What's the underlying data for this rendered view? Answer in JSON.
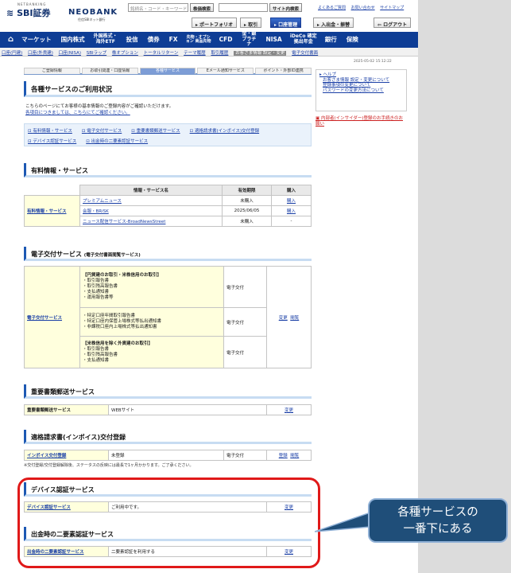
{
  "header": {
    "sbi_sub": "NETBANKING",
    "sbi_logo": "SBI証券",
    "neo_logo": "NEOBANK",
    "neo_sub": "住信SBIネット銀行",
    "search_placeholder": "銘柄名・コード・キーワード",
    "search_button": "株価検索",
    "site_search_button": "サイト内検索",
    "top_links": [
      "よくあるご質問",
      "お問い合わせ",
      "サイトマップ"
    ],
    "nav_buttons": [
      "ポートフォリオ",
      "取引",
      "口座管理",
      "入出金・振替"
    ],
    "logout": "ログアウト"
  },
  "main_nav": {
    "items": [
      "マーケット",
      "国内株式",
      "外国株式・海外ETF",
      "投信",
      "債券",
      "FX",
      "先物・オプション 商品先物",
      "CFD",
      "金・銀プラチナ",
      "NISA",
      "iDeCo 確定拠出年金",
      "銀行",
      "保険"
    ]
  },
  "sub_nav": {
    "items": [
      "口座(円建)",
      "口座(外貨建)",
      "口座(NISA)",
      "SBIラップ",
      "株オプション",
      "トータルリターン",
      "テーマ履歴",
      "取引履歴",
      "お客さま情報 設定・変更",
      "電子交付書面"
    ],
    "active_index": 8
  },
  "datestamp": "2025-05-02 15:12:22",
  "tabs": [
    "ご登録情報",
    "お取引関連・口座情報",
    "各種サービス",
    "Eメール通知サービス",
    "ポイント・外部ID連携"
  ],
  "page_title": "各種サービスのご利用状況",
  "intro": {
    "line1": "こちらのページにてお客様の基本情報のご登録内容がご確認いただけます。",
    "line2": "各項目につきましては、こちらにてご確認ください。"
  },
  "quick_links": {
    "row1": [
      "有料情報・サービス",
      "電子交付サービス",
      "重要書類郵送サービス",
      "適格請求書(インボイス)交付登録"
    ],
    "row2": [
      "デバイス認証サービス",
      "出金時の二要素認証サービス"
    ]
  },
  "paid": {
    "title": "有料情報・サービス",
    "headers": [
      "情報・サービス名",
      "有効期限",
      "購入"
    ],
    "row_label": "有料情報・サービス",
    "rows": [
      {
        "name": "プレミアムニュース",
        "expiry": "未購入",
        "action": "購入"
      },
      {
        "name": "会報・BRiSK",
        "expiry": "2025/06/05",
        "action": "購入"
      },
      {
        "name": "ニュース配信サービス-BroadNewsStreet",
        "expiry": "未購入",
        "action": "-"
      }
    ]
  },
  "edelivery": {
    "title": "電子交付サービス",
    "title_sub": "(電子交付書面閲覧サービス)",
    "row_label": "電子交付サービス",
    "groups": [
      {
        "head": "【円貨建のお取引・米株信用のお取引】",
        "items": "・取引報告書\n・取引残高報告書\n・支払通知書\n・運用報告書等",
        "status": "電子交付"
      },
      {
        "head": "",
        "items": "・特定口座年間取引報告書\n・特定口座内保管上場株式等払出通知書\n・非課税口座内上場株式等払出通知書",
        "status": "電子交付"
      },
      {
        "head": "【米株信用を除く外貨建のお取引】",
        "items": "・取引報告書\n・取引残高報告書\n・支払通知書",
        "status": "電子交付"
      }
    ],
    "actions": [
      "変更",
      "閲覧"
    ]
  },
  "mail": {
    "title": "重要書類郵送サービス",
    "label": "重要書類郵送サービス",
    "value": "WEBサイト",
    "action": "変更"
  },
  "invoice": {
    "title": "適格請求書(インボイス)交付登録",
    "label": "インボイス交付登録",
    "value": "未登録",
    "status": "電子交付",
    "actions": [
      "登録",
      "閲覧"
    ],
    "note": "※交付登録/交付登録解除後、ステータスの反映には最長で1ヶ月かかります。ご了承ください。"
  },
  "device": {
    "title": "デバイス認証サービス",
    "label": "デバイス認証サービス",
    "value": "ご利用中です。",
    "action": "変更"
  },
  "twofactor": {
    "title": "出金時の二要素認証サービス",
    "label": "出金時の二要素認証サービス",
    "value": "二要素認証を利用する",
    "action": "変更"
  },
  "sidebar": {
    "help": "ヘルプ",
    "items": [
      "お客さま情報 設定・変更について",
      "登録事項の変更について",
      "パスワードの変更方法について"
    ],
    "insider": "内部者(インサイダー)登録のお手続きのお願い"
  },
  "callout": {
    "line1": "各種サービスの",
    "line2": "一番下にある"
  },
  "colors": {
    "nav": "#0e3d95",
    "highlight": "#e01919",
    "callout": "#1f4e79"
  }
}
